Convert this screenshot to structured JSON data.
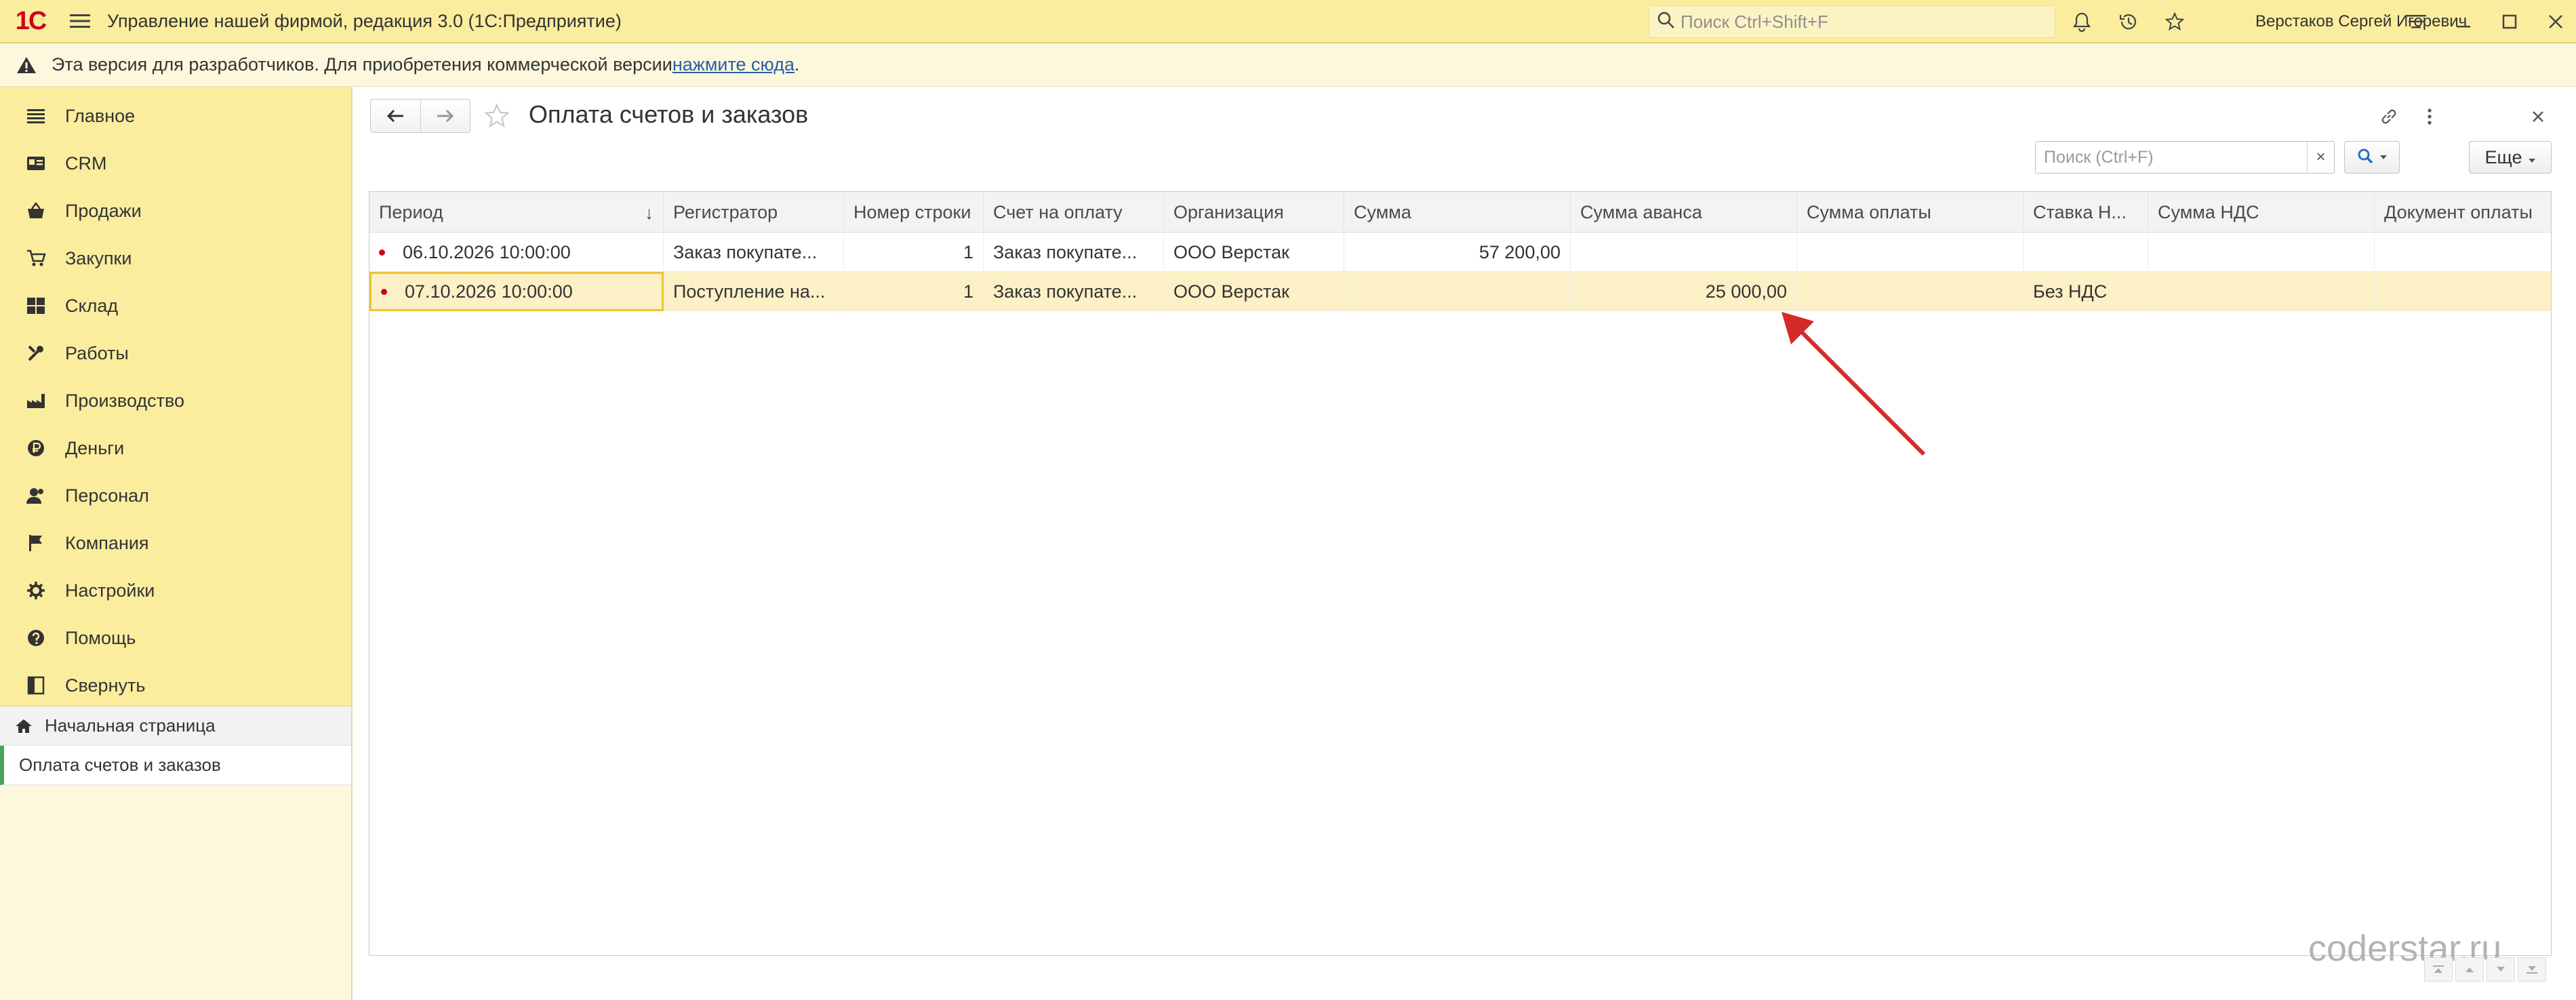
{
  "titlebar": {
    "logo": "1С",
    "title": "Управление нашей фирмой, редакция 3.0  (1С:Предприятие)",
    "search_placeholder": "Поиск Ctrl+Shift+F",
    "user": "Верстаков Сергей Игоревич"
  },
  "warning": {
    "text": "Эта версия для разработчиков. Для приобретения коммерческой версии ",
    "link": "нажмите сюда",
    "suffix": "."
  },
  "sidebar": {
    "items": [
      {
        "label": "Главное",
        "icon": "list-icon"
      },
      {
        "label": "CRM",
        "icon": "crm-icon"
      },
      {
        "label": "Продажи",
        "icon": "sales-icon"
      },
      {
        "label": "Закупки",
        "icon": "purchases-icon"
      },
      {
        "label": "Склад",
        "icon": "warehouse-icon"
      },
      {
        "label": "Работы",
        "icon": "tools-icon"
      },
      {
        "label": "Производство",
        "icon": "factory-icon"
      },
      {
        "label": "Деньги",
        "icon": "money-icon"
      },
      {
        "label": "Персонал",
        "icon": "people-icon"
      },
      {
        "label": "Компания",
        "icon": "flag-icon"
      },
      {
        "label": "Настройки",
        "icon": "gear-icon"
      },
      {
        "label": "Помощь",
        "icon": "help-icon"
      },
      {
        "label": "Свернуть",
        "icon": "collapse-icon"
      }
    ],
    "home": "Начальная страница",
    "open_window": "Оплата счетов и заказов"
  },
  "form": {
    "title": "Оплата счетов и заказов",
    "find_placeholder": "Поиск (Ctrl+F)",
    "find_clear": "×",
    "more": "Еще"
  },
  "table": {
    "columns": [
      "Период",
      "Регистратор",
      "Номер строки",
      "Счет на оплату",
      "Организация",
      "Сумма",
      "Сумма аванса",
      "Сумма оплаты",
      "Ставка Н...",
      "Сумма НДС",
      "Документ оплаты"
    ],
    "sort_indicator": "↓",
    "rows": [
      {
        "period": "06.10.2026 10:00:00",
        "registrar": "Заказ покупате...",
        "line": "1",
        "invoice": "Заказ покупате...",
        "org": "ООО Верстак",
        "sum": "57 200,00",
        "advance": "",
        "payment": "",
        "vat_rate": "",
        "vat_sum": "",
        "doc": ""
      },
      {
        "period": "07.10.2026 10:00:00",
        "registrar": "Поступление на...",
        "line": "1",
        "invoice": "Заказ покупате...",
        "org": "ООО Верстак",
        "sum": "",
        "advance": "25 000,00",
        "payment": "",
        "vat_rate": "Без НДС",
        "vat_sum": "",
        "doc": ""
      }
    ]
  },
  "watermark": "coderstar.ru",
  "colors": {
    "accent_yellow": "#fbed9e",
    "selection": "#fbf0c6",
    "focus_border": "#f1c232",
    "arrow": "#d42a2a",
    "active_marker": "#4aa35b"
  }
}
